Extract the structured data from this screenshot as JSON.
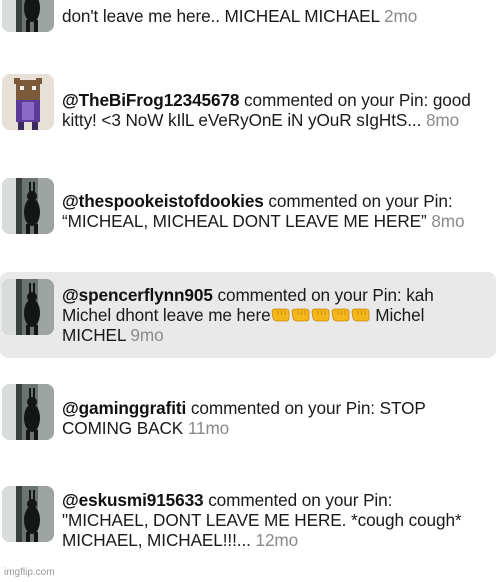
{
  "notifications": [
    {
      "avatar": "shadow-figure-thumbnail",
      "username": "",
      "before": "",
      "action": "",
      "comment": "don't leave me here.. MICHEAL MICHAEL",
      "age": "2mo",
      "highlighted": false
    },
    {
      "avatar": "pixel-cat-thumbnail",
      "username": "@TheBiFrog12345678",
      "action": " commented on your Pin: ",
      "comment": "good kitty! <3 NoW kIlL eVeRyOnE iN yOuR sIgHtS...",
      "age": "8mo",
      "highlighted": false
    },
    {
      "avatar": "shadow-figure-thumbnail",
      "username": "@thespookeistofdookies",
      "action": " commented on your Pin: ",
      "comment": "“MICHEAL, MICHEAL DONT LEAVE ME HERE”",
      "age": "8mo",
      "highlighted": false
    },
    {
      "avatar": "shadow-figure-thumbnail",
      "username": "@spencerflynn905",
      "action": " commented on your Pin: ",
      "comment_before_emoji": "kah Michel dhont leave me here",
      "emoji_count": 5,
      "comment_after_emoji": " Michel MICHEL",
      "age": "9mo",
      "highlighted": true
    },
    {
      "avatar": "shadow-figure-thumbnail",
      "username": "@gaminggrafiti",
      "action": " commented on your Pin: ",
      "comment": "STOP COMING BACK",
      "age": "11mo",
      "highlighted": false
    },
    {
      "avatar": "shadow-figure-thumbnail",
      "username": "@eskusmi915633",
      "action": " commented on your Pin: ",
      "comment": "\"MICHAEL, DONT LEAVE ME HERE. *cough cough* MICHAEL, MICHAEL!!!...",
      "age": "12mo",
      "highlighted": false
    }
  ],
  "watermark": "imgflip.com",
  "colors": {
    "highlight": "#e9e9e9",
    "age": "#8a8a8a",
    "emoji": "#f5b61b"
  }
}
